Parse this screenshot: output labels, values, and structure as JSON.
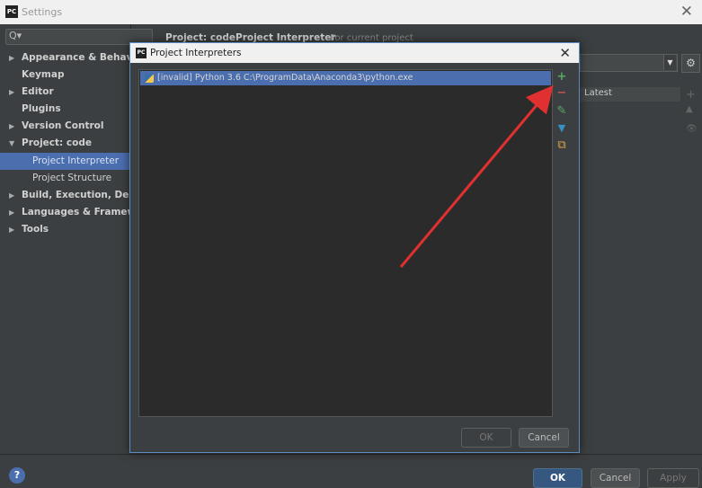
{
  "window": {
    "title": "Settings",
    "logo_text": "PC",
    "close_glyph": "✕"
  },
  "search": {
    "icon": "Q▾",
    "placeholder": ""
  },
  "sidebar": {
    "items": [
      {
        "label": "Appearance & Behavior",
        "expandable": true,
        "arrow": "▶"
      },
      {
        "label": "Keymap",
        "expandable": false,
        "arrow": ""
      },
      {
        "label": "Editor",
        "expandable": true,
        "arrow": "▶"
      },
      {
        "label": "Plugins",
        "expandable": false,
        "arrow": ""
      },
      {
        "label": "Version Control",
        "expandable": true,
        "arrow": "▶"
      },
      {
        "label": "Project: code",
        "expandable": true,
        "arrow": "▼"
      },
      {
        "label": "Project Interpreter",
        "child": true,
        "selected": true
      },
      {
        "label": "Project Structure",
        "child": true
      },
      {
        "label": "Build, Execution, Deployment",
        "expandable": true,
        "arrow": "▶"
      },
      {
        "label": "Languages & Frameworks",
        "expandable": true,
        "arrow": "▶"
      },
      {
        "label": "Tools",
        "expandable": true,
        "arrow": "▶"
      }
    ]
  },
  "breadcrumb": {
    "project": "Project: code",
    "separator": "›",
    "page": "Project Interpreter",
    "note": "For current project"
  },
  "background_panel": {
    "column_header": "Latest",
    "gear_icon": "⚙",
    "combo_arrow": "▼",
    "plus": "+",
    "up": "▲",
    "eye": "👁"
  },
  "dialog": {
    "title": "Project Interpreters",
    "logo_text": "PC",
    "close_glyph": "✕",
    "interpreters": [
      {
        "text": "[invalid] Python 3.6 C:\\ProgramData\\Anaconda3\\python.exe",
        "selected": true
      }
    ],
    "tools": {
      "add": {
        "glyph": "+",
        "color": "#59a869"
      },
      "remove": {
        "glyph": "−",
        "color": "#c75450"
      },
      "edit": {
        "glyph": "✎",
        "color": "#59a869"
      },
      "filter": {
        "glyph": "▼",
        "color": "#3592c4"
      },
      "paths": {
        "glyph": "⧉",
        "color": "#d9a343"
      }
    },
    "ok_label": "OK",
    "cancel_label": "Cancel"
  },
  "footer": {
    "help_glyph": "?",
    "ok_label": "OK",
    "cancel_label": "Cancel",
    "apply_label": "Apply"
  },
  "annotation": {
    "arrow_color": "#e03030"
  }
}
